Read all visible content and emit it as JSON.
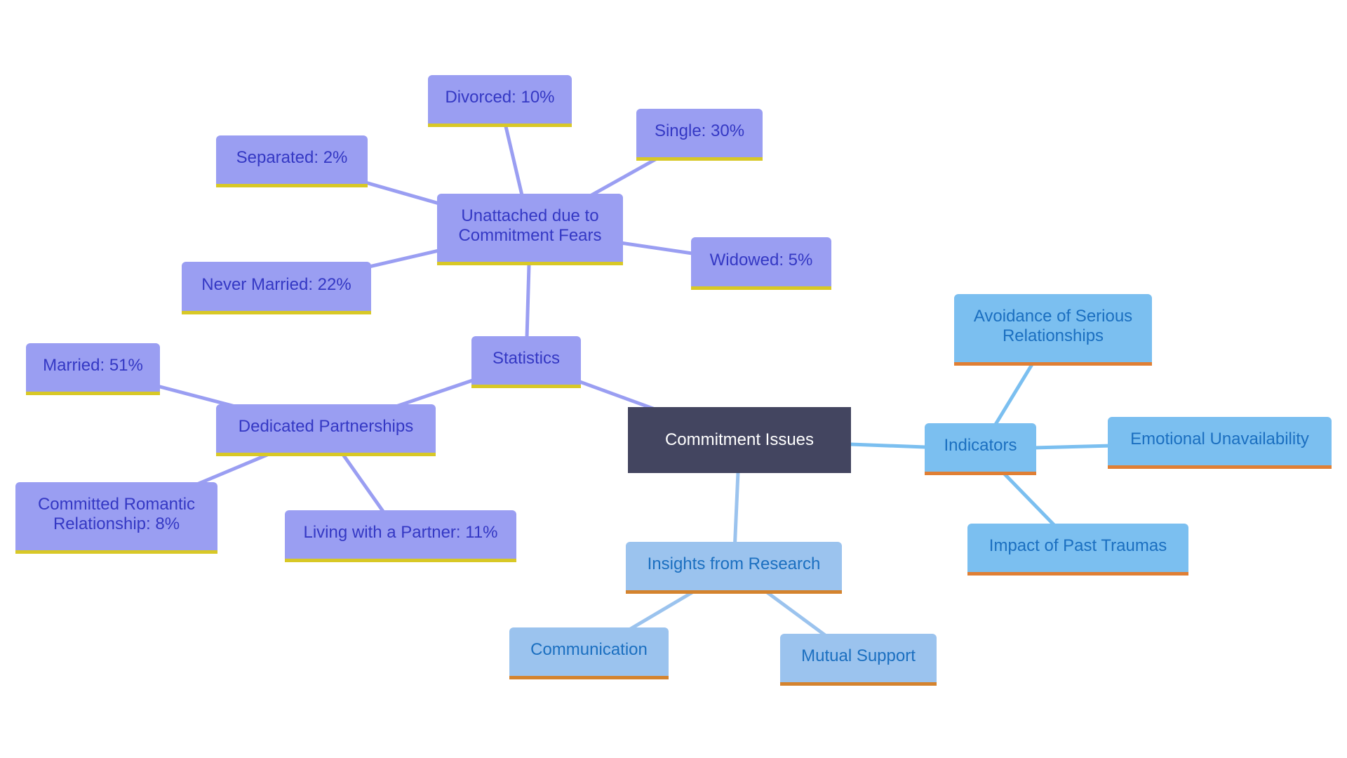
{
  "root": {
    "label": "Commitment Issues"
  },
  "statistics": {
    "label": "Statistics",
    "unattached": {
      "label": "Unattached due to Commitment Fears",
      "children": [
        "Divorced: 10%",
        "Single: 30%",
        "Separated: 2%",
        "Never Married: 22%",
        "Widowed: 5%"
      ]
    },
    "dedicated": {
      "label": "Dedicated Partnerships",
      "children": [
        "Married: 51%",
        "Committed Romantic Relationship: 8%",
        "Living with a Partner: 11%"
      ]
    }
  },
  "indicators": {
    "label": "Indicators",
    "children": [
      "Avoidance of Serious Relationships",
      "Emotional Unavailability",
      "Impact of Past Traumas"
    ]
  },
  "research": {
    "label": "Insights from Research",
    "children": [
      "Communication",
      "Mutual Support"
    ]
  },
  "colors": {
    "root_fill": "#434560",
    "statistics_fill": "#9a9ef2",
    "statistics_text": "#3438c4",
    "statistics_accent": "#d8c826",
    "indicators_fill": "#7bbff0",
    "indicators_text": "#1b6fc0",
    "indicators_accent": "#e07f34",
    "research_fill": "#9bc3ee",
    "research_accent": "#d4832e"
  }
}
